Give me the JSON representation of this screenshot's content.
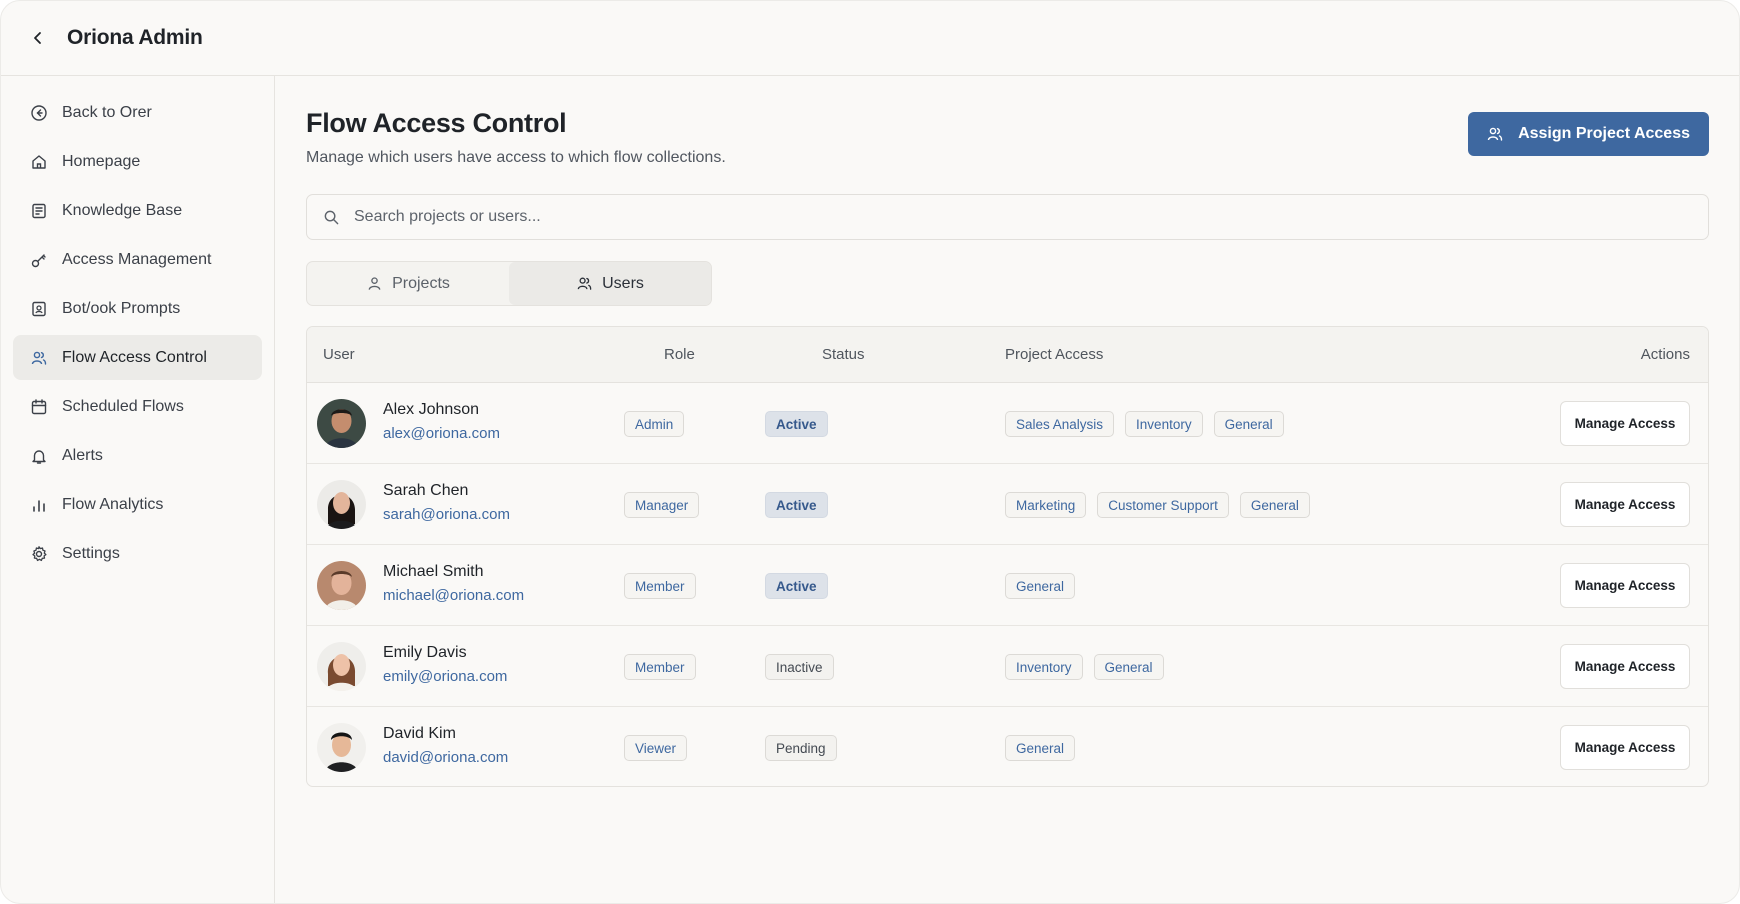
{
  "app": {
    "title": "Oriona Admin"
  },
  "sidebar": {
    "items": [
      {
        "label": "Back to Orer",
        "icon": "back-circle-icon",
        "active": false
      },
      {
        "label": "Homepage",
        "icon": "home-icon",
        "active": false
      },
      {
        "label": "Knowledge Base",
        "icon": "book-icon",
        "active": false
      },
      {
        "label": "Access Management",
        "icon": "key-icon",
        "active": false
      },
      {
        "label": "Bot/ook Prompts",
        "icon": "prompt-book-icon",
        "active": false
      },
      {
        "label": "Flow Access Control",
        "icon": "users-icon",
        "active": true
      },
      {
        "label": "Scheduled Flows",
        "icon": "calendar-icon",
        "active": false
      },
      {
        "label": "Alerts",
        "icon": "bell-icon",
        "active": false
      },
      {
        "label": "Flow Analytics",
        "icon": "bar-chart-icon",
        "active": false
      },
      {
        "label": "Settings",
        "icon": "gear-icon",
        "active": false
      }
    ]
  },
  "main": {
    "title": "Flow Access Control",
    "subtitle": "Manage which users have access to which flow collections.",
    "assign_button": "Assign Project Access",
    "search_placeholder": "Search projects or users...",
    "tabs": [
      {
        "label": "Projects",
        "active": false
      },
      {
        "label": "Users",
        "active": true
      }
    ]
  },
  "table": {
    "columns": [
      "User",
      "Role",
      "Status",
      "Project Access",
      "Actions"
    ],
    "rows": [
      {
        "name": "Alex Johnson",
        "email": "alex@oriona.com",
        "role": "Admin",
        "status": "Active",
        "projects": [
          "Sales Analysis",
          "Inventory",
          "General"
        ],
        "action": "Manage Access"
      },
      {
        "name": "Sarah Chen",
        "email": "sarah@oriona.com",
        "role": "Manager",
        "status": "Active",
        "projects": [
          "Marketing",
          "Customer Support",
          "General"
        ],
        "action": "Manage Access"
      },
      {
        "name": "Michael Smith",
        "email": "michael@oriona.com",
        "role": "Member",
        "status": "Active",
        "projects": [
          "General"
        ],
        "action": "Manage Access"
      },
      {
        "name": "Emily Davis",
        "email": "emily@oriona.com",
        "role": "Member",
        "status": "Inactive",
        "projects": [
          "Inventory",
          "General"
        ],
        "action": "Manage Access"
      },
      {
        "name": "David Kim",
        "email": "david@oriona.com",
        "role": "Viewer",
        "status": "Pending",
        "projects": [
          "General"
        ],
        "action": "Manage Access"
      }
    ]
  },
  "colors": {
    "accent": "#3e68a0",
    "background": "#faf9f7",
    "active_badge": "#dde2e9"
  }
}
